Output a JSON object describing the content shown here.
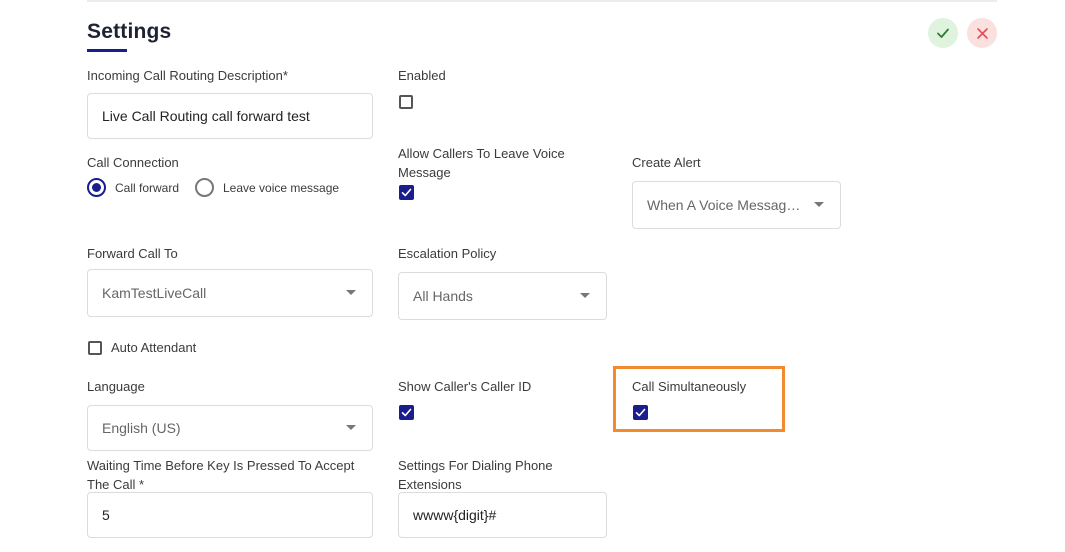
{
  "page": {
    "title": "Settings",
    "actions": {
      "save_icon": "check-icon",
      "cancel_icon": "close-icon"
    }
  },
  "fields": {
    "description": {
      "label": "Incoming Call Routing Description*",
      "value": "Live Call Routing call forward test"
    },
    "enabled": {
      "label": "Enabled",
      "checked": false
    },
    "call_connection": {
      "label": "Call Connection",
      "options": [
        "Call forward",
        "Leave voice message"
      ],
      "selected": "Call forward"
    },
    "allow_voice_message": {
      "label": "Allow Callers To Leave Voice Message",
      "checked": true
    },
    "create_alert": {
      "label": "Create Alert",
      "value": "When A Voice Message ..."
    },
    "forward_call_to": {
      "label": "Forward Call To",
      "value": "KamTestLiveCall"
    },
    "escalation_policy": {
      "label": "Escalation Policy",
      "value": "All Hands"
    },
    "auto_attendant": {
      "label": "Auto Attendant",
      "checked": false
    },
    "language": {
      "label": "Language",
      "value": "English (US)"
    },
    "show_caller_id": {
      "label": "Show Caller's Caller ID",
      "checked": true
    },
    "call_simultaneously": {
      "label": "Call Simultaneously",
      "checked": true
    },
    "waiting_time": {
      "label": "Waiting Time Before Key Is Pressed To Accept The Call *",
      "value": "5"
    },
    "dialing_extensions": {
      "label": "Settings For Dialing Phone Extensions",
      "value": "wwww{digit}#"
    }
  },
  "colors": {
    "accent": "#1a1d8c",
    "highlight": "#f28a2e",
    "save_bg": "#dff3df",
    "save_icon": "#2e7d32",
    "cancel_bg": "#fbe0e0",
    "cancel_icon": "#e0505a"
  }
}
